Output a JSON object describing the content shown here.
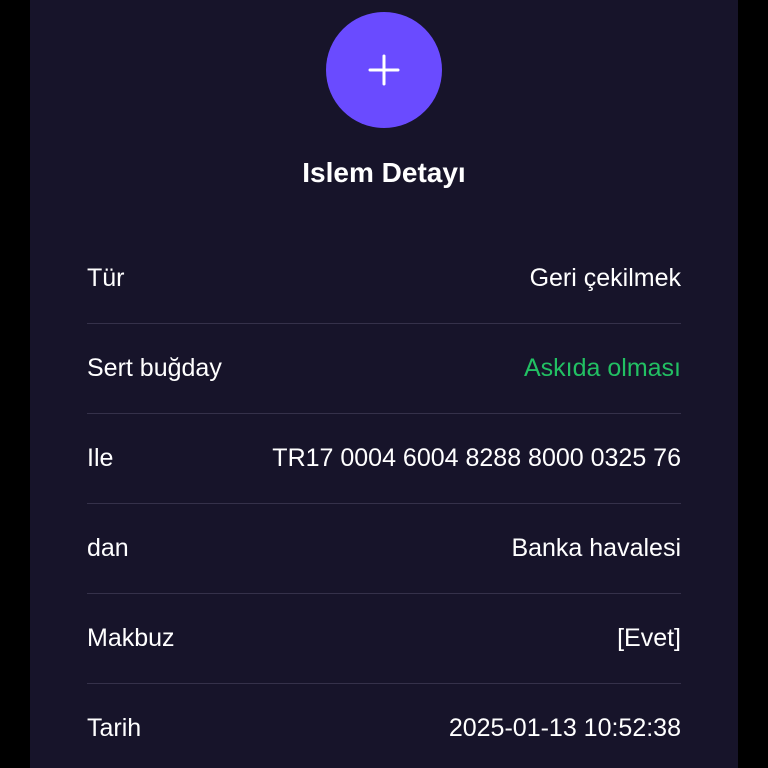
{
  "header": {
    "icon": "plus-icon",
    "title": "Islem Detayı"
  },
  "colors": {
    "background": "#17142a",
    "accent": "#6a4bff",
    "status_pending": "#22c063",
    "divider": "#35314a"
  },
  "details": [
    {
      "label": "Tür",
      "value": "Geri çekilmek"
    },
    {
      "label": "Sert buğday",
      "value": "Askıda olması"
    },
    {
      "label": "Ile",
      "value": "TR17 0004 6004 8288 8000 0325 76"
    },
    {
      "label": "dan",
      "value": "Banka havalesi"
    },
    {
      "label": "Makbuz",
      "value": "[Evet]"
    },
    {
      "label": "Tarih",
      "value": "2025-01-13 10:52:38"
    }
  ]
}
